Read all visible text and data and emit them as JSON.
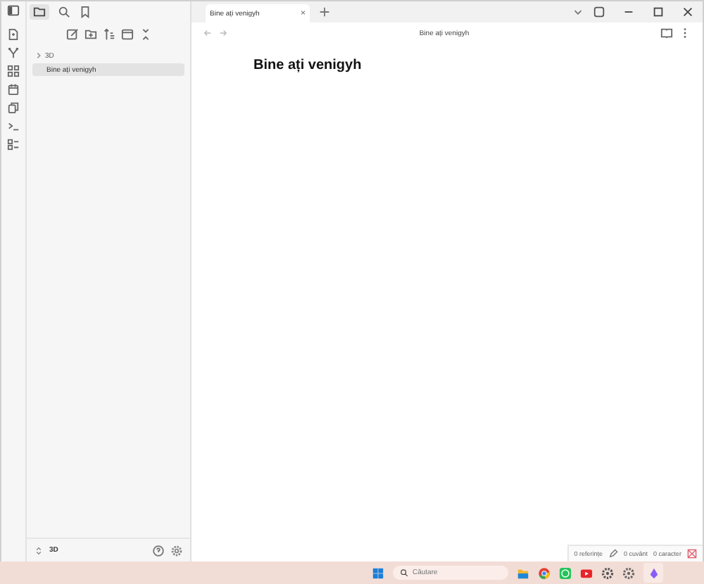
{
  "tabs": [
    {
      "label": "Bine ați venigyh",
      "selected": true,
      "close": "×"
    }
  ],
  "sidebar": {
    "tree": [
      {
        "label": "3D",
        "kind": "folder",
        "expanded": false
      },
      {
        "label": "Bine ați venigyh",
        "kind": "note",
        "selected": true
      }
    ],
    "vault": "3D"
  },
  "editor": {
    "title": "Bine ați venigyh",
    "heading": "Bine ați venigyh"
  },
  "status_bar": {
    "backlinks": "0 referințe",
    "words": "0 cuvânt",
    "characters": "0 caracter"
  },
  "taskbar": {
    "search": {
      "placeholder": "Căutare"
    }
  }
}
